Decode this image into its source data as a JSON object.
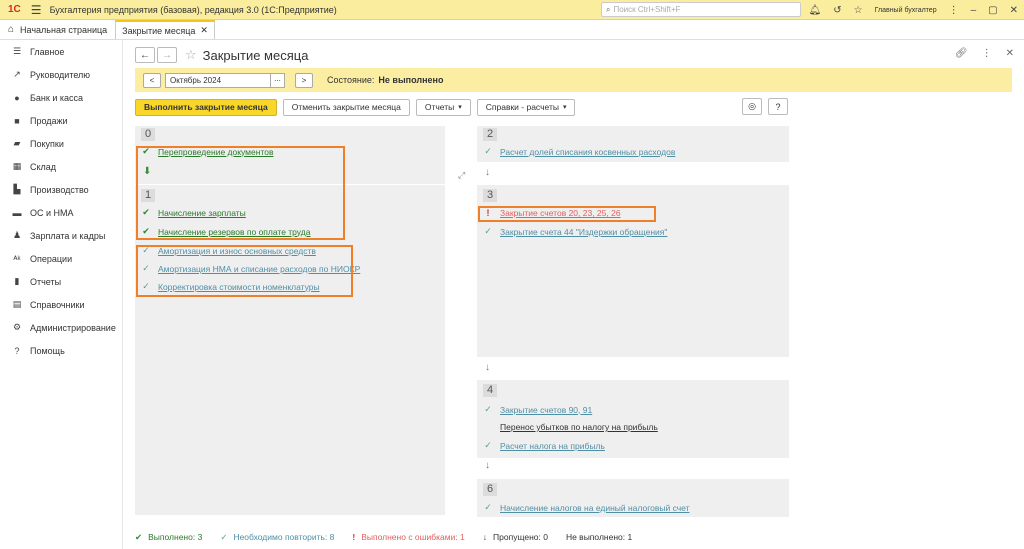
{
  "app": {
    "logo": "1С",
    "title": "Бухгалтерия предприятия (базовая), редакция 3.0  (1С:Предприятие)",
    "search_placeholder": "Поиск Ctrl+Shift+F",
    "user": "Главный бухгалтер"
  },
  "tabs": {
    "home": "Начальная страница",
    "active": "Закрытие месяца"
  },
  "sidebar": {
    "items": [
      {
        "label": "Главное",
        "icon": "menu-icon"
      },
      {
        "label": "Руководителю",
        "icon": "chart-icon"
      },
      {
        "label": "Банк и касса",
        "icon": "coins-icon"
      },
      {
        "label": "Продажи",
        "icon": "bag-icon"
      },
      {
        "label": "Покупки",
        "icon": "cart-icon"
      },
      {
        "label": "Склад",
        "icon": "warehouse-icon"
      },
      {
        "label": "Производство",
        "icon": "factory-icon"
      },
      {
        "label": "ОС и НМА",
        "icon": "truck-icon"
      },
      {
        "label": "Зарплата и кадры",
        "icon": "person-icon"
      },
      {
        "label": "Операции",
        "icon": "operations-icon"
      },
      {
        "label": "Отчеты",
        "icon": "report-icon"
      },
      {
        "label": "Справочники",
        "icon": "book-icon"
      },
      {
        "label": "Администрирование",
        "icon": "gear-icon"
      },
      {
        "label": "Помощь",
        "icon": "help-icon"
      }
    ]
  },
  "form": {
    "title": "Закрытие месяца",
    "period": "Октябрь 2024",
    "state_label": "Состояние:",
    "state_value": "Не выполнено",
    "prev": "<",
    "next": ">",
    "dots": "..."
  },
  "actions": {
    "run": "Выполнить закрытие месяца",
    "cancel": "Отменить закрытие месяца",
    "reports": "Отчеты",
    "certificates": "Справки - расчеты"
  },
  "stages": {
    "s0": {
      "num": "0",
      "ops": [
        {
          "label": "Перепроведение документов",
          "status": "done"
        }
      ]
    },
    "s1": {
      "num": "1",
      "ops": [
        {
          "label": "Начисление зарплаты",
          "status": "done"
        },
        {
          "label": "Начисление резервов по оплате труда",
          "status": "done"
        },
        {
          "label": "Амортизация и износ основных средств",
          "status": "repeat"
        },
        {
          "label": "Амортизация НМА и списание расходов по НИОКР",
          "status": "repeat"
        },
        {
          "label": "Корректировка стоимости номенклатуры",
          "status": "repeat"
        }
      ]
    },
    "s2": {
      "num": "2",
      "ops": [
        {
          "label": "Расчет долей списания косвенных расходов",
          "status": "repeat"
        }
      ]
    },
    "s3": {
      "num": "3",
      "ops": [
        {
          "label": "Закрытие счетов 20, 23, 25, 26",
          "status": "error"
        },
        {
          "label": "Закрытие счета 44 \"Издержки обращения\"",
          "status": "repeat"
        }
      ]
    },
    "s4": {
      "num": "4",
      "ops": [
        {
          "label": "Закрытие счетов 90, 91",
          "status": "repeat"
        },
        {
          "label": "Перенос убытков по налогу на прибыль",
          "status": "none"
        },
        {
          "label": "Расчет налога на прибыль",
          "status": "repeat"
        }
      ]
    },
    "s6": {
      "num": "6",
      "ops": [
        {
          "label": "Начисление налогов на единый налоговый счет",
          "status": "repeat"
        }
      ]
    }
  },
  "footer": {
    "done": "Выполнено: 3",
    "repeat": "Необходимо повторить: 8",
    "errors": "Выполнено с ошибками: 1",
    "skipped": "Пропущено: 0",
    "not_done": "Не выполнено: 1"
  },
  "colors": {
    "accent": "#f9d72a",
    "highlight": "#f07f2a",
    "done": "#2a7a2a",
    "repeat": "#4f8fa5",
    "error": "#d63030"
  }
}
